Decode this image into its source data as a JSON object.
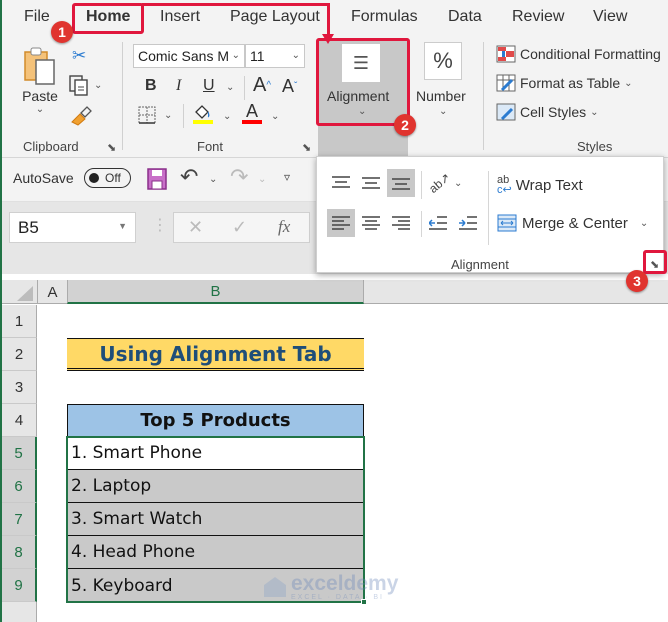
{
  "tabs": [
    {
      "label": "File"
    },
    {
      "label": "Home",
      "active": true
    },
    {
      "label": "Insert"
    },
    {
      "label": "Page Layout"
    },
    {
      "label": "Formulas"
    },
    {
      "label": "Data"
    },
    {
      "label": "Review"
    },
    {
      "label": "View"
    }
  ],
  "ribbon": {
    "clipboard": {
      "label": "Clipboard",
      "paste_label": "Paste"
    },
    "font": {
      "label": "Font",
      "font_name": "Comic Sans M",
      "font_size": "11",
      "bold": "B",
      "italic": "I",
      "underline": "U",
      "grow": "A",
      "shrink": "A",
      "font_color_letter": "A",
      "fill_color": "#ffff00",
      "font_color": "#ff0000"
    },
    "alignment": {
      "label": "Alignment"
    },
    "number": {
      "label": "Number",
      "glyph": "%"
    },
    "styles": {
      "label": "Styles",
      "conditional_formatting": "Conditional Formatting",
      "format_as_table": "Format as Table",
      "cell_styles": "Cell Styles"
    }
  },
  "qat": {
    "autosave_label": "AutoSave",
    "toggle_state": "Off"
  },
  "formula_bar": {
    "name_box": "B5",
    "fx": "fx",
    "cancel": "✕",
    "enter": "✓"
  },
  "alignment_popup": {
    "wrap_text": "Wrap Text",
    "merge_center": "Merge & Center",
    "group_label": "Alignment"
  },
  "annotations": {
    "step1": "1",
    "step2": "2",
    "step3": "3",
    "color": "#e0173d"
  },
  "sheet": {
    "columns": [
      "A",
      "B"
    ],
    "rows": [
      "1",
      "2",
      "3",
      "4",
      "5",
      "6",
      "7",
      "8",
      "9"
    ],
    "title": "Using Alignment Tab",
    "table_header": "Top 5 Products",
    "items": [
      "1. Smart Phone",
      "2. Laptop",
      "3. Smart Watch",
      "4. Head Phone",
      "5. Keyboard"
    ],
    "title_fill": "#ffd966",
    "title_color": "#1f4e79",
    "header_fill": "#9dc3e6",
    "item_fill": "#c9c9c9"
  },
  "watermark": {
    "brand": "exceldemy",
    "tagline": "EXCEL · DATA · BI"
  }
}
